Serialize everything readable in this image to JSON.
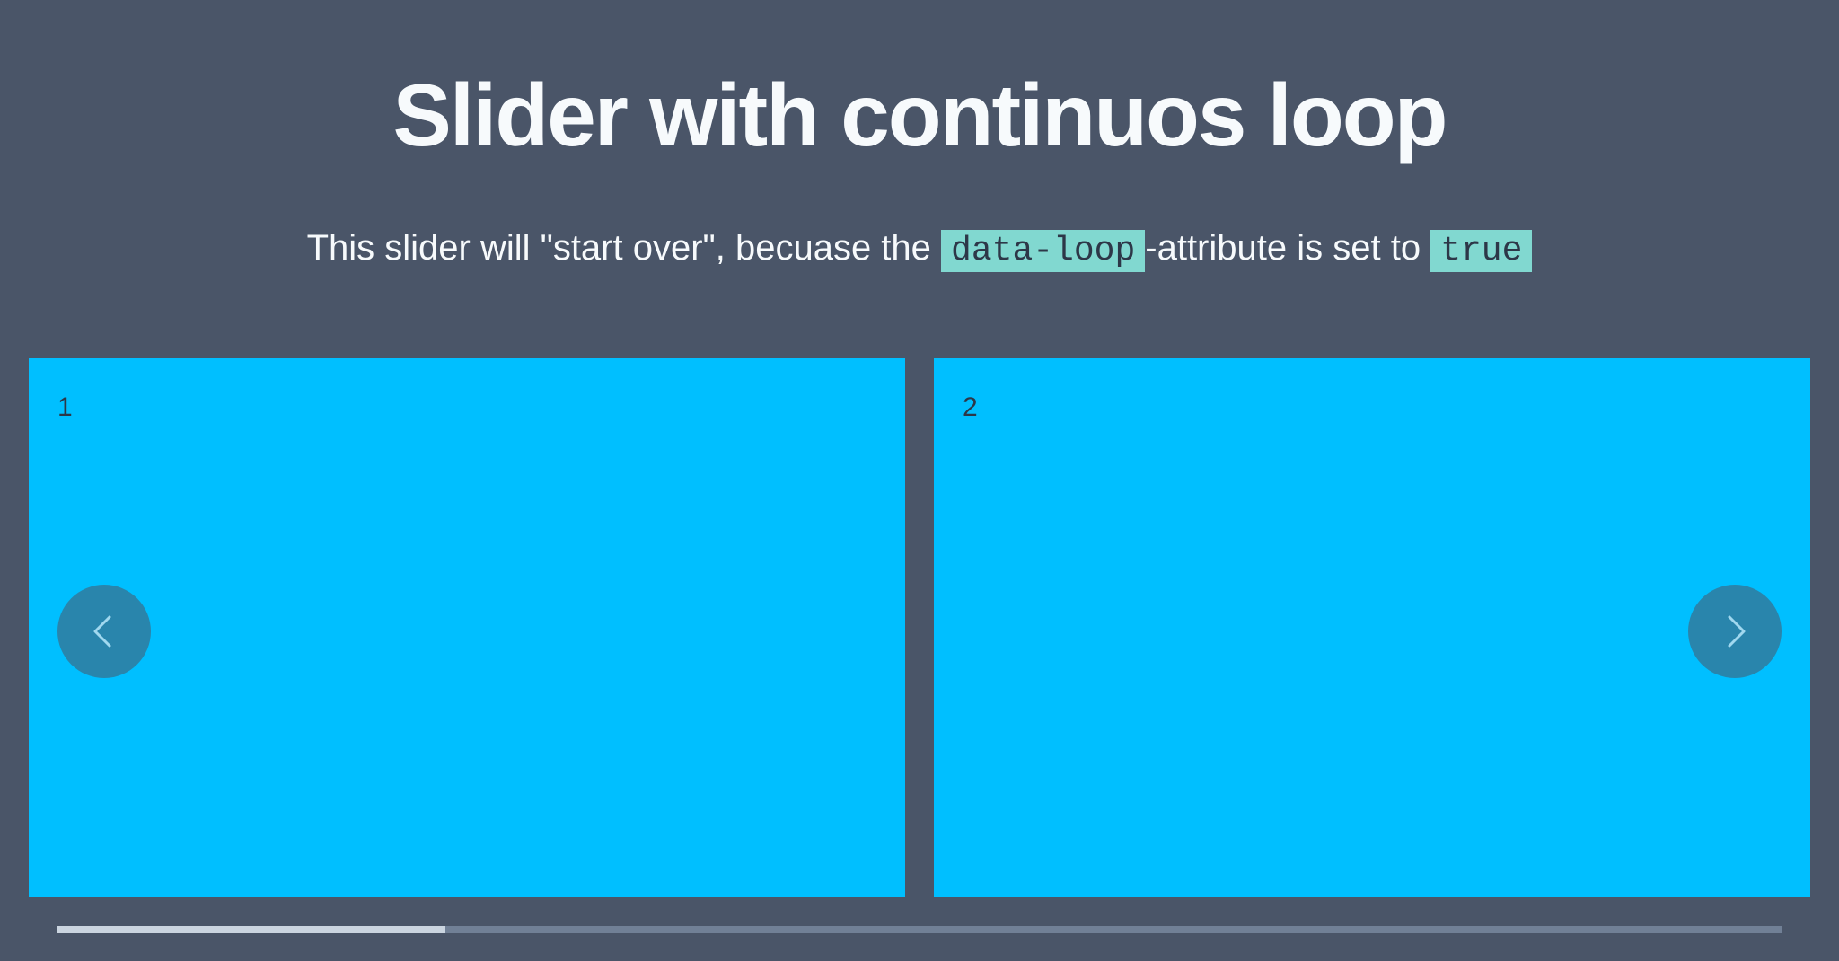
{
  "header": {
    "title": "Slider with continuos loop"
  },
  "description": {
    "before": "This slider will \"start over\", becuase the ",
    "code_attr": "data-loop",
    "middle": "-attribute is set to ",
    "code_value": "true"
  },
  "slider": {
    "slides": [
      {
        "label": "1"
      },
      {
        "label": "2"
      }
    ],
    "prev_icon": "chevron-left-icon",
    "next_icon": "chevron-right-icon",
    "progress": 0.225
  },
  "colors": {
    "background": "#4a5568",
    "slide": "#00bfff",
    "code_highlight": "#81d8d0"
  }
}
